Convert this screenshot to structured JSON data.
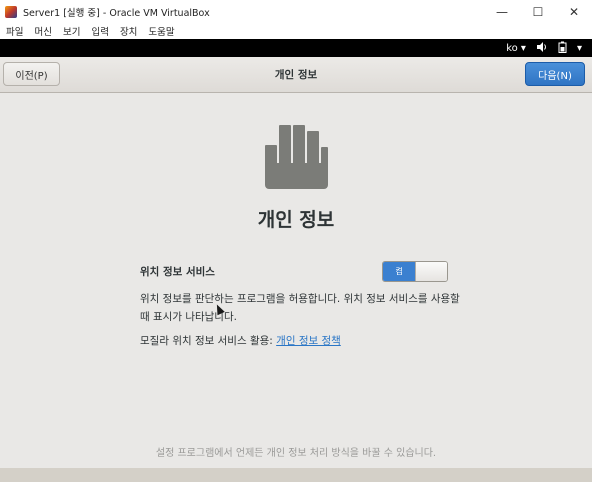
{
  "window": {
    "title": "Server1 [실행 중] - Oracle VM VirtualBox",
    "controls": {
      "minimize": "—",
      "maximize": "☐",
      "close": "✕"
    }
  },
  "menubar": {
    "items": [
      "파일",
      "머신",
      "보기",
      "입력",
      "장치",
      "도움말"
    ]
  },
  "topbar": {
    "language": "ko ▾",
    "volume_icon": "volume-icon",
    "battery_icon": "battery-icon",
    "menu_arrow": "▾"
  },
  "header": {
    "prev_label": "이전(P)",
    "title": "개인 정보",
    "next_label": "다음(N)",
    "accent_color": "#3b80d0"
  },
  "content": {
    "icon": "hand-stop-icon",
    "heading": "개인 정보",
    "location_service_label": "위치 정보 서비스",
    "toggle_state_text": "켬",
    "description": "위치 정보를 판단하는 프로그램을 허용합니다. 위치 정보 서비스를 사용할 때 표시가 나타납니다.",
    "link_prefix": "모질라 위치 정보 서비스 활용: ",
    "link_text": "개인 정보 정책",
    "footer": "설정 프로그램에서 언제든 개인 정보 처리 방식을 바꿀 수 있습니다."
  }
}
